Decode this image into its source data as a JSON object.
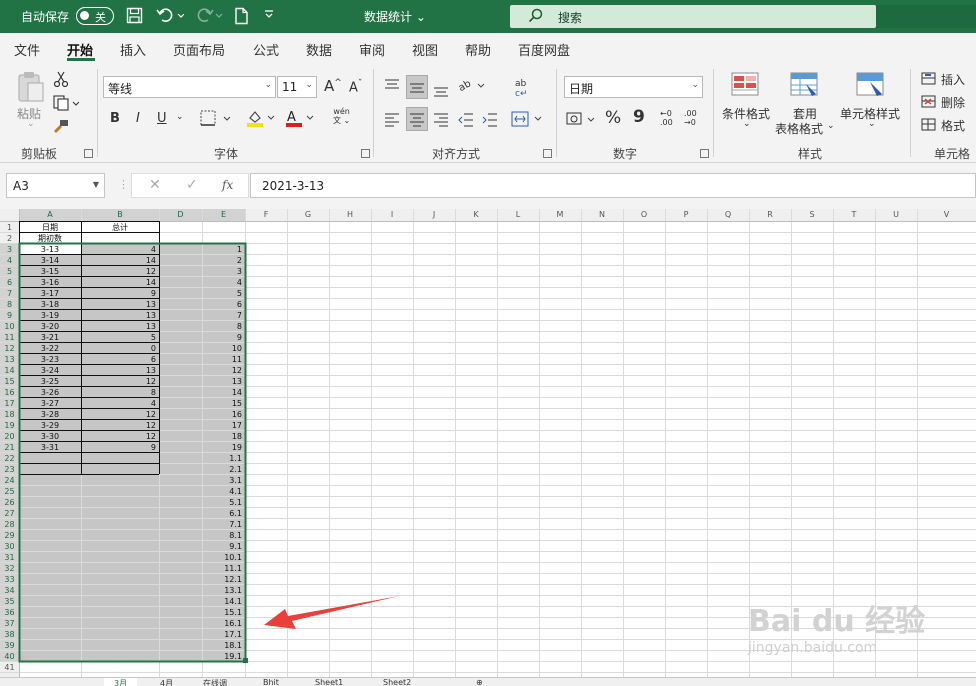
{
  "titlebar": {
    "autosave_label": "自动保存",
    "autosave_state": "关",
    "doc_title": "数据统计",
    "search_placeholder": "搜索"
  },
  "menu": {
    "tabs": [
      "文件",
      "开始",
      "插入",
      "页面布局",
      "公式",
      "数据",
      "审阅",
      "视图",
      "帮助",
      "百度网盘"
    ],
    "active": "开始"
  },
  "ribbon": {
    "clipboard": {
      "paste": "粘贴",
      "label": "剪贴板"
    },
    "font": {
      "name": "等线",
      "size": "11",
      "label": "字体",
      "grow": "A",
      "shrink": "A",
      "bold": "B",
      "italic": "I",
      "underline": "U",
      "phonetic": "wén"
    },
    "alignment": {
      "label": "对齐方式"
    },
    "number": {
      "format": "日期",
      "label": "数字",
      "percent": "%",
      "comma": "9"
    },
    "styles": {
      "conditional": "条件格式",
      "table_line1": "套用",
      "table_line2": "表格格式",
      "cell_styles": "单元格样式",
      "label": "样式"
    },
    "cells": {
      "insert": "插入",
      "delete": "删除",
      "format": "格式",
      "label": "单元格"
    }
  },
  "formula_bar": {
    "name_box": "A3",
    "fx": "fx",
    "content": "2021-3-13"
  },
  "grid": {
    "columns": [
      "A",
      "B",
      "D",
      "E",
      "F",
      "G",
      "H",
      "I",
      "J",
      "K",
      "L",
      "M",
      "N",
      "O",
      "P",
      "Q",
      "R",
      "S",
      "T",
      "U",
      "V"
    ],
    "row_numbers": [
      "1",
      "2",
      "3",
      "4",
      "5",
      "6",
      "7",
      "8",
      "9",
      "10",
      "11",
      "12",
      "13",
      "14",
      "15",
      "16",
      "17",
      "18",
      "19",
      "20",
      "21",
      "22",
      "23",
      "24",
      "25",
      "26",
      "27",
      "28",
      "29",
      "30",
      "31",
      "32",
      "33",
      "34",
      "35",
      "36",
      "37",
      "38",
      "39",
      "40",
      "41"
    ],
    "header_a": "日期",
    "header_b": "总计",
    "row2_a": "期初数",
    "col_a": [
      "3-13",
      "3-14",
      "3-15",
      "3-16",
      "3-17",
      "3-18",
      "3-19",
      "3-20",
      "3-21",
      "3-22",
      "3-23",
      "3-24",
      "3-25",
      "3-26",
      "3-27",
      "3-28",
      "3-29",
      "3-30",
      "3-31"
    ],
    "col_b": [
      "4",
      "14",
      "12",
      "14",
      "9",
      "13",
      "13",
      "13",
      "5",
      "0",
      "6",
      "13",
      "12",
      "8",
      "4",
      "12",
      "12",
      "12",
      "9"
    ],
    "col_e": [
      "1",
      "2",
      "3",
      "4",
      "5",
      "6",
      "7",
      "8",
      "9",
      "10",
      "11",
      "12",
      "13",
      "14",
      "15",
      "16",
      "17",
      "18",
      "19",
      "1.1",
      "2.1",
      "3.1",
      "4.1",
      "5.1",
      "6.1",
      "7.1",
      "8.1",
      "9.1",
      "10.1",
      "11.1",
      "12.1",
      "13.1",
      "14.1",
      "15.1",
      "16.1",
      "17.1",
      "18.1",
      "19.1"
    ]
  },
  "sheet_tabs": [
    "3月",
    "4月",
    "在线调",
    "Bhit",
    "Sheet1",
    "Sheet2"
  ],
  "watermark": {
    "brand": "Bai du 经验",
    "url": "jingyan.baidu.com"
  },
  "colors": {
    "accent": "#217346",
    "selection_fill": "#c6c6c6",
    "arrow": "#e8413b"
  }
}
